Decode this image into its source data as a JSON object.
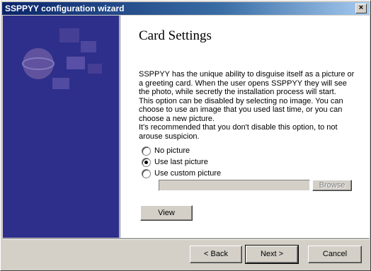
{
  "window": {
    "title": "SSPPYY configuration wizard",
    "close_label": "×"
  },
  "page": {
    "heading": "Card Settings",
    "description": "SSPPYY has the unique ability to disguise itself as a picture or a greeting card. When the user opens SSPPYY they will see the photo, while secretly the installation process will start.\nThis option can be disabled by selecting no image. You can choose to use an image that you used last time, or you can choose a new picture.\nIt's recommended that you don't disable this option, to not arouse suspicion.",
    "options": [
      {
        "label": "No picture",
        "checked": false
      },
      {
        "label": "Use last picture",
        "checked": true
      },
      {
        "label": "Use custom picture",
        "checked": false
      }
    ],
    "custom_path_value": "",
    "browse_label": "Browse",
    "view_label": "View"
  },
  "footer": {
    "back_label": "< Back",
    "next_label": "Next >",
    "cancel_label": "Cancel"
  },
  "colors": {
    "titlebar_start": "#0a246a",
    "banner": "#2d2f8a",
    "face": "#d4d0c8"
  }
}
